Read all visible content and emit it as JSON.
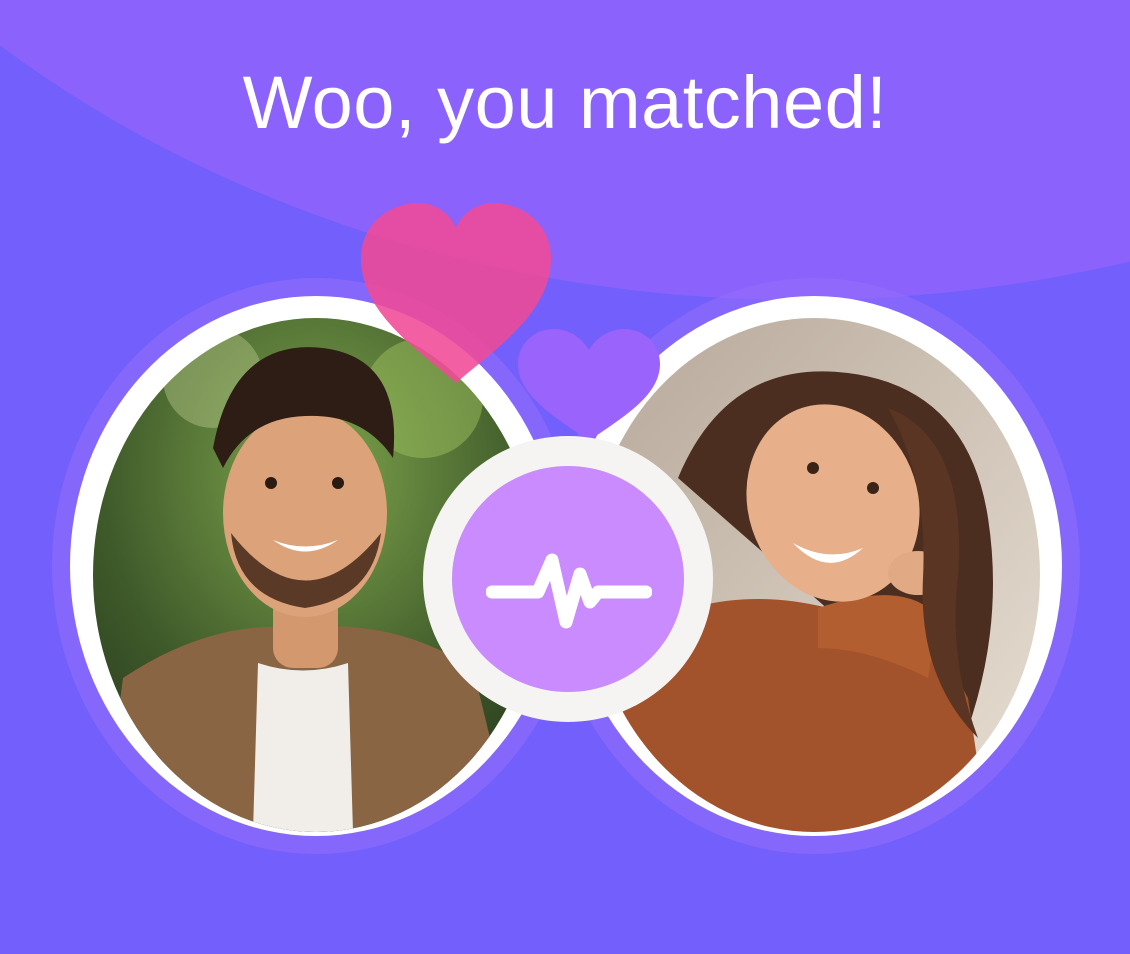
{
  "headline": "Woo, you matched!",
  "icons": {
    "center": "heartbeat-pulse-icon",
    "hearts": [
      "pink-heart-icon",
      "purple-heart-icon"
    ]
  },
  "colors": {
    "background": "#735ffb",
    "background_band": "#8c62fc",
    "ring": "#ffffff",
    "pink_heart": "#f04a96",
    "purple_heart": "#9a63fb",
    "badge": "#c98bfd"
  }
}
